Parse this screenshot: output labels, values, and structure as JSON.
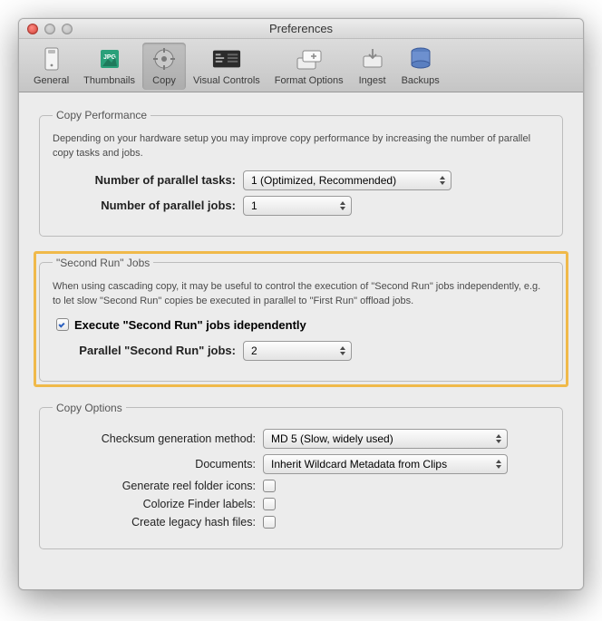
{
  "window": {
    "title": "Preferences"
  },
  "toolbar": {
    "items": [
      {
        "label": "General"
      },
      {
        "label": "Thumbnails"
      },
      {
        "label": "Copy"
      },
      {
        "label": "Visual Controls"
      },
      {
        "label": "Format Options"
      },
      {
        "label": "Ingest"
      },
      {
        "label": "Backups"
      }
    ]
  },
  "copy_perf": {
    "legend": "Copy Performance",
    "desc": "Depending on your hardware setup you may improve copy performance by increasing the number of parallel copy tasks and jobs.",
    "tasks_label": "Number of parallel tasks:",
    "tasks_value": "1 (Optimized, Recommended)",
    "jobs_label": "Number of parallel jobs:",
    "jobs_value": "1"
  },
  "second_run": {
    "legend": "\"Second Run\" Jobs",
    "desc": "When using cascading copy, it may be useful to control the execution of \"Second Run\" jobs independently, e.g. to let slow \"Second Run\" copies be executed in parallel to \"First Run\" offload jobs.",
    "checkbox_label": "Execute \"Second Run\" jobs idependently",
    "checkbox_checked": true,
    "parallel_label": "Parallel \"Second Run\" jobs:",
    "parallel_value": "2"
  },
  "copy_options": {
    "legend": "Copy Options",
    "checksum_label": "Checksum generation method:",
    "checksum_value": "MD 5 (Slow, widely used)",
    "documents_label": "Documents:",
    "documents_value": "Inherit Wildcard Metadata from Clips",
    "reel_label": "Generate reel folder icons:",
    "colorize_label": "Colorize Finder labels:",
    "legacy_label": "Create legacy hash files:"
  }
}
